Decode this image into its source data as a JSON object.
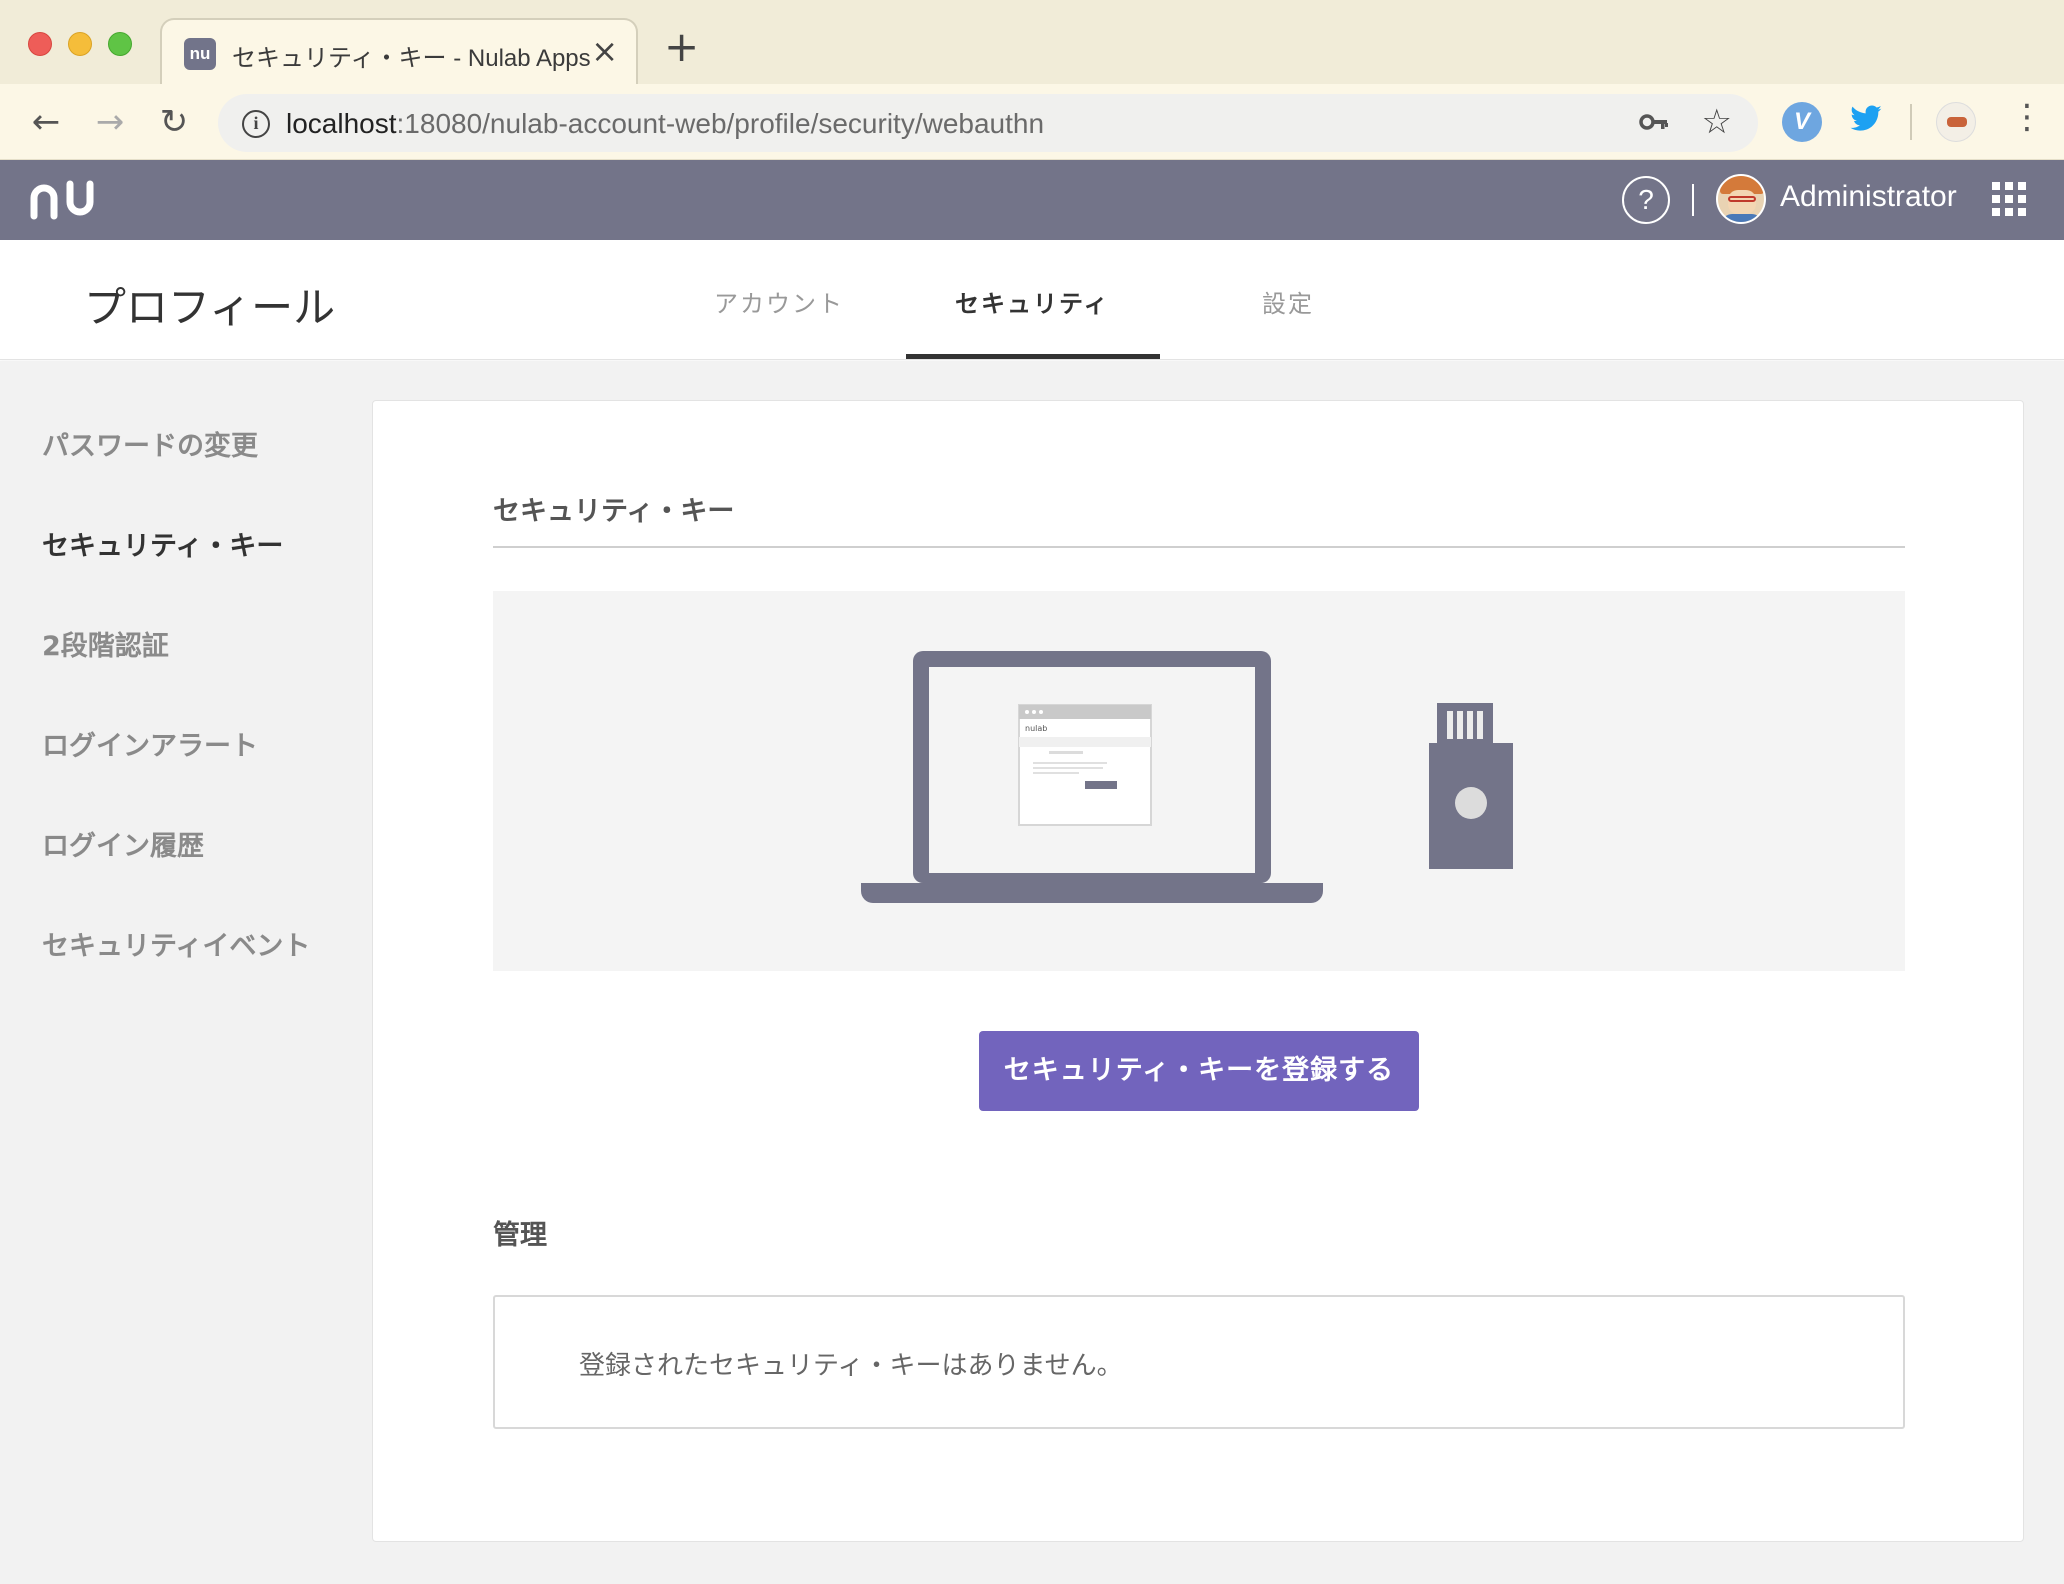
{
  "browser": {
    "tab_title": "セキュリティ・キー - Nulab Apps",
    "tab_favicon_text": "nu",
    "tab_close": "×",
    "new_tab": "+",
    "url_host": "localhost",
    "url_path": ":18080/nulab-account-web/profile/security/webauthn",
    "back_icon": "←",
    "forward_icon": "→",
    "reload_icon": "↻",
    "info_icon": "i",
    "key_icon": "key-icon",
    "star_icon": "☆",
    "menu_icon": "⋮",
    "extensions": [
      "vivaldi-icon",
      "twitter-icon",
      "profile-icon"
    ]
  },
  "header": {
    "help": "?",
    "user_name": "Administrator",
    "accent_color": "#737489"
  },
  "profile_nav": {
    "title": "プロフィール",
    "tabs": [
      {
        "label": "アカウント",
        "active": false
      },
      {
        "label": "セキュリティ",
        "active": true
      },
      {
        "label": "設定",
        "active": false
      }
    ]
  },
  "sidebar": {
    "items": [
      {
        "label": "パスワードの変更",
        "active": false
      },
      {
        "label": "セキュリティ・キー",
        "active": true
      },
      {
        "label": "2段階認証",
        "active": false
      },
      {
        "label": "ログインアラート",
        "active": false
      },
      {
        "label": "ログイン履歴",
        "active": false
      },
      {
        "label": "セキュリティイベント",
        "active": false
      }
    ]
  },
  "main": {
    "section_title": "セキュリティ・キー",
    "register_button": "セキュリティ・キーを登録する",
    "button_color": "#7264bd",
    "manage_title": "管理",
    "empty_message": "登録されたセキュリティ・キーはありません。",
    "illustration_dialog_logo": "nulab"
  }
}
